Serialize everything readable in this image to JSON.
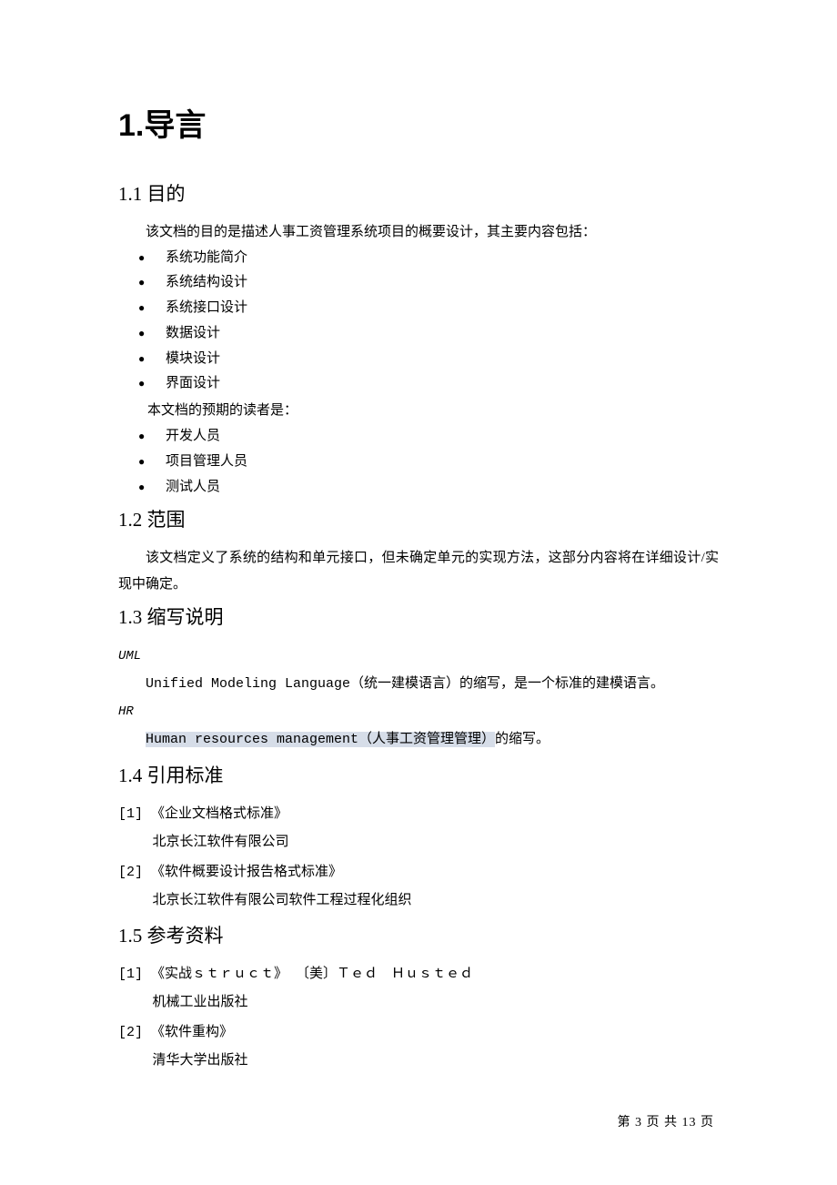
{
  "title": "1.导言",
  "section_1_1": {
    "heading": "1.1 目的",
    "intro": "该文档的目的是描述人事工资管理系统项目的概要设计，其主要内容包括：",
    "bullets1": [
      "系统功能简介",
      "系统结构设计",
      "系统接口设计",
      "数据设计",
      "模块设计",
      "界面设计"
    ],
    "mid": "本文档的预期的读者是：",
    "bullets2": [
      "开发人员",
      "项目管理人员",
      "测试人员"
    ]
  },
  "section_1_2": {
    "heading": "1.2 范围",
    "body": "该文档定义了系统的结构和单元接口，但未确定单元的实现方法，这部分内容将在详细设计/实现中确定。"
  },
  "section_1_3": {
    "heading": "1.3 缩写说明",
    "term1": "UML",
    "def1": "Unified Modeling Language（统一建模语言）的缩写，是一个标准的建模语言。",
    "term2": "HR",
    "def2_hl": "Human resources management（人事工资管理管理）",
    "def2_tail": "的缩写。"
  },
  "section_1_4": {
    "heading": "1.4 引用标准",
    "ref1_line1": "[1] 《企业文档格式标准》",
    "ref1_line2": "北京长江软件有限公司",
    "ref2_line1": "[2] 《软件概要设计报告格式标准》",
    "ref2_line2": "北京长江软件有限公司软件工程过程化组织"
  },
  "section_1_5": {
    "heading": "1.5 参考资料",
    "ref1_line1": "[1] 《实战ｓｔｒｕｃｔ》 〔美〕Ｔｅｄ　Ｈｕｓｔｅｄ",
    "ref1_line2": "机械工业出版社",
    "ref2_line1": "[2] 《软件重构》",
    "ref2_line2": "清华大学出版社"
  },
  "footer": "第 3 页 共 13 页"
}
